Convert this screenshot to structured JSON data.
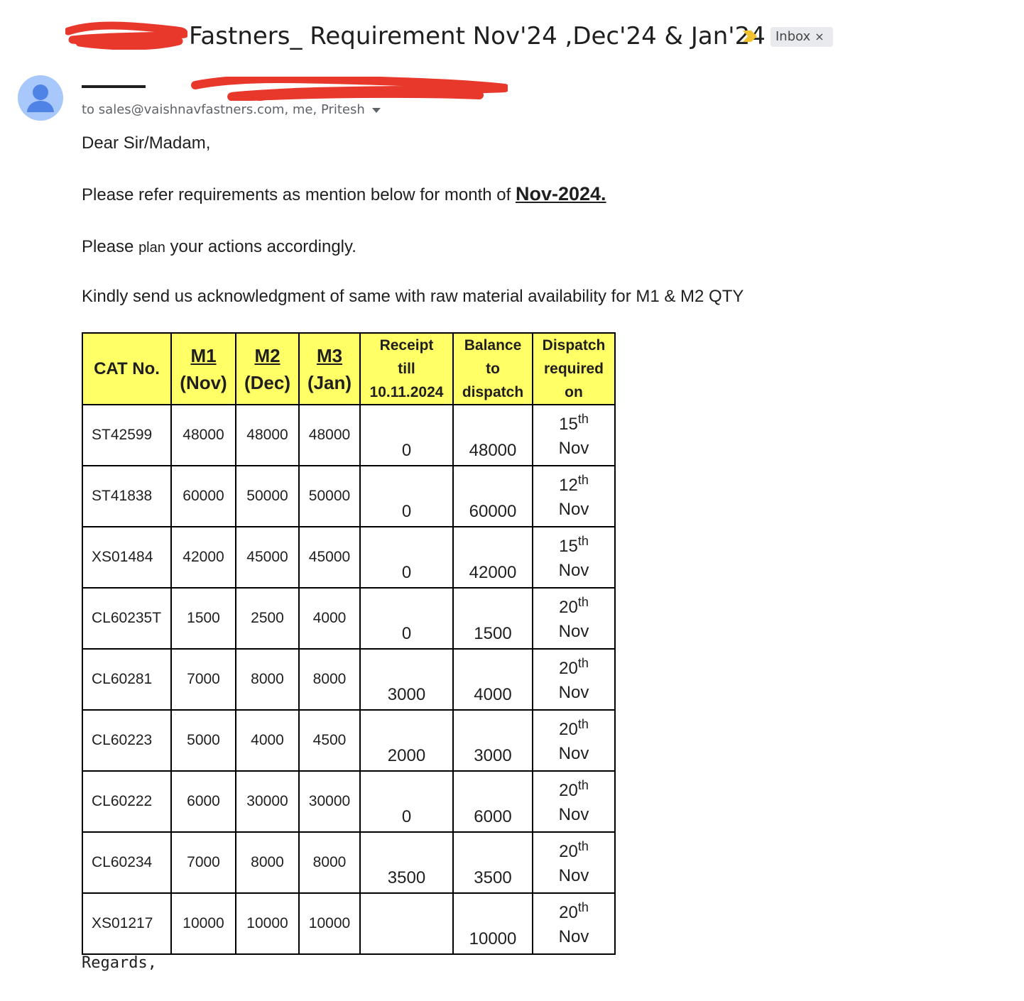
{
  "subject": "Fastners_ Requirement Nov'24 ,Dec'24 & Jan'24",
  "label_chip": "Inbox",
  "label_chip_close": "×",
  "recipients": "to sales@vaishnavfastners.com, me, Pritesh",
  "body": {
    "greeting": "Dear Sir/Madam,",
    "line1_prefix": "Please refer requirements as mention below for month of ",
    "line1_month": "Nov-2024.",
    "line2_a": "Please ",
    "line2_b": "plan",
    "line2_c": " your actions accordingly.",
    "line3": "Kindly send us acknowledgment of same with raw material availability for M1 & M2 QTY",
    "closing": "Regards,"
  },
  "table": {
    "headers": {
      "cat": "CAT No.",
      "m1_top": "M1",
      "m1_bottom": "(Nov)",
      "m2_top": "M2",
      "m2_bottom": "(Dec)",
      "m3_top": "M3",
      "m3_bottom": "(Jan)",
      "receipt_1": "Receipt",
      "receipt_2": "till",
      "receipt_3": "10.11.2024",
      "balance_1": "Balance",
      "balance_2": "to",
      "balance_3": "dispatch",
      "dispatch_1": "Dispatch",
      "dispatch_2": "required",
      "dispatch_3": "on"
    },
    "rows": [
      {
        "cat": "ST42599",
        "m1": "48000",
        "m2": "48000",
        "m3": "48000",
        "receipt": "0",
        "balance": "48000",
        "day": "15",
        "sup": "th",
        "month": "Nov"
      },
      {
        "cat": "ST41838",
        "m1": "60000",
        "m2": "50000",
        "m3": "50000",
        "receipt": "0",
        "balance": "60000",
        "day": "12",
        "sup": "th",
        "month": "Nov"
      },
      {
        "cat": "XS01484",
        "m1": "42000",
        "m2": "45000",
        "m3": "45000",
        "receipt": "0",
        "balance": "42000",
        "day": "15",
        "sup": "th",
        "month": "Nov"
      },
      {
        "cat": "CL60235T",
        "m1": "1500",
        "m2": "2500",
        "m3": "4000",
        "receipt": "0",
        "balance": "1500",
        "day": "20",
        "sup": "th",
        "month": "Nov"
      },
      {
        "cat": "CL60281",
        "m1": "7000",
        "m2": "8000",
        "m3": "8000",
        "receipt": "3000",
        "balance": "4000",
        "day": "20",
        "sup": "th",
        "month": "Nov"
      },
      {
        "cat": "CL60223",
        "m1": "5000",
        "m2": "4000",
        "m3": "4500",
        "receipt": "2000",
        "balance": "3000",
        "day": "20",
        "sup": "th",
        "month": "Nov"
      },
      {
        "cat": "CL60222",
        "m1": "6000",
        "m2": "30000",
        "m3": "30000",
        "receipt": "0",
        "balance": "6000",
        "day": "20",
        "sup": "th",
        "month": "Nov"
      },
      {
        "cat": "CL60234",
        "m1": "7000",
        "m2": "8000",
        "m3": "8000",
        "receipt": "3500",
        "balance": "3500",
        "day": "20",
        "sup": "th",
        "month": "Nov"
      },
      {
        "cat": "XS01217",
        "m1": "10000",
        "m2": "10000",
        "m3": "10000",
        "receipt": "",
        "balance": "10000",
        "day": "20",
        "sup": "th",
        "month": "Nov"
      }
    ]
  },
  "colors": {
    "header_fill": "#ffff66",
    "redaction": "#e8382c",
    "avatar_bg": "#a8c7fa",
    "avatar_fg": "#4f83e6",
    "important_marker": "#f2c12e"
  },
  "icons": [
    "avatar-person-icon",
    "important-marker-icon",
    "chevron-down-icon",
    "close-icon"
  ]
}
